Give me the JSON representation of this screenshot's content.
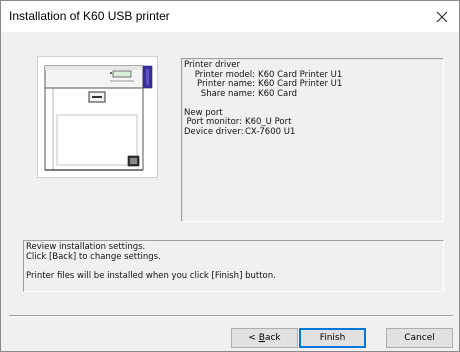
{
  "window": {
    "title": "Installation of K60 USB printer"
  },
  "icons": {
    "close": "close-icon",
    "printer": "printer-illustration",
    "accent_color": "#3a2f9a"
  },
  "info": {
    "driver_heading": "Printer driver",
    "printer_model_label": "Printer model:",
    "printer_model_value": "K60 Card Printer U1",
    "printer_name_label": "Printer name:",
    "printer_name_value": "K60 Card Printer U1",
    "share_name_label": "Share name:",
    "share_name_value": "K60 Card",
    "port_heading": "New port",
    "port_monitor_label": "Port monitor:",
    "port_monitor_value": "K60_U Port",
    "device_driver_label": "Device driver:",
    "device_driver_value": "CX-7600 U1"
  },
  "message": {
    "line1": "Review installation settings.",
    "line2": "Click [Back] to change settings.",
    "line3": "Printer files will be installed when you click [Finish] button."
  },
  "buttons": {
    "back_prefix": "< ",
    "back_mnemonic": "B",
    "back_rest": "ack",
    "finish": "Finish",
    "cancel": "Cancel"
  }
}
